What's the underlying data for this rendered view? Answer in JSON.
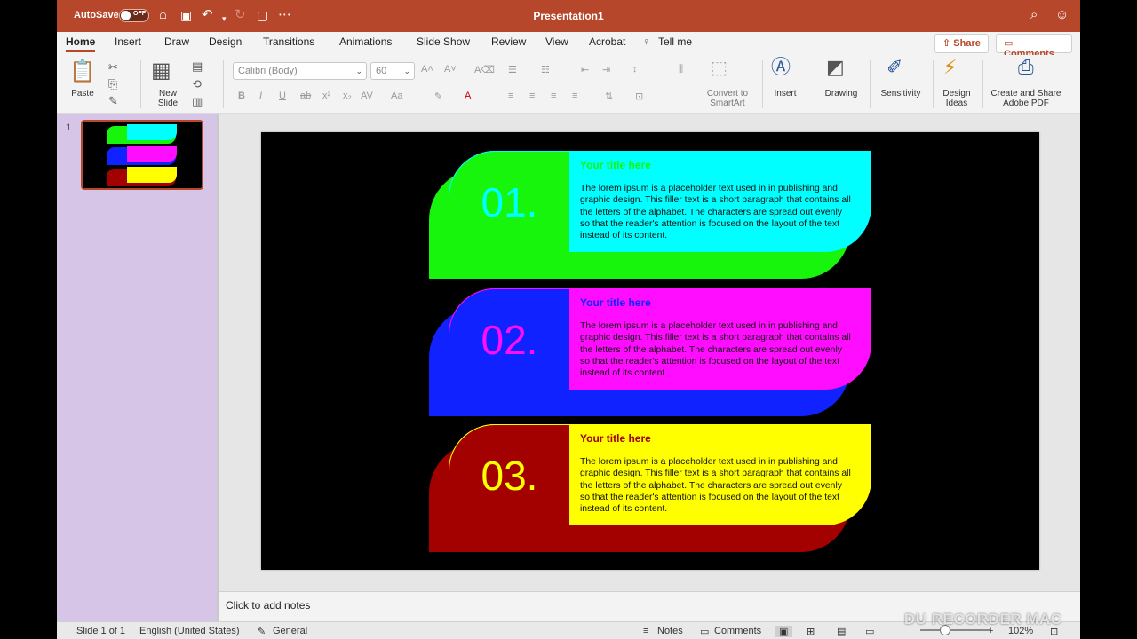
{
  "titlebar": {
    "autosave_label": "AutoSave",
    "autosave_state": "OFF",
    "document_title": "Presentation1"
  },
  "tabs": [
    "Home",
    "Insert",
    "Draw",
    "Design",
    "Transitions",
    "Animations",
    "Slide Show",
    "Review",
    "View",
    "Acrobat",
    "Tell me"
  ],
  "active_tab": "Home",
  "top_buttons": {
    "share": "Share",
    "comments": "Comments"
  },
  "ribbon": {
    "paste": "Paste",
    "new_slide_line1": "New",
    "new_slide_line2": "Slide",
    "font_name": "Calibri (Body)",
    "font_size": "60",
    "convert_smartart_line1": "Convert to",
    "convert_smartart_line2": "SmartArt",
    "insert": "Insert",
    "drawing": "Drawing",
    "sensitivity": "Sensitivity",
    "design_ideas_line1": "Design",
    "design_ideas_line2": "Ideas",
    "adobe_line1": "Create and Share",
    "adobe_line2": "Adobe PDF"
  },
  "thumbnail": {
    "number": "1"
  },
  "slide": {
    "items": [
      {
        "number": "01.",
        "title": "Your title here",
        "body": "The lorem ipsum is a placeholder text used in in publishing and graphic design.  This filler text is a short paragraph that contains all the letters of the alphabet. The characters are spread out evenly so that the reader's attention is focused on the layout of the text instead of its content.",
        "colors": {
          "back": "#17f50c",
          "numbox": "#17f50c",
          "panel": "#00ffff",
          "number": "#00ffff",
          "title": "#17f50c"
        }
      },
      {
        "number": "02.",
        "title": "Your title here",
        "body": "The lorem ipsum is a placeholder text used in in publishing and graphic design.  This filler text is a short paragraph that contains all the letters of the alphabet. The characters are spread out evenly so that the reader's attention is focused on the layout of the text instead of its content.",
        "colors": {
          "back": "#1022ff",
          "numbox": "#1022ff",
          "panel": "#ff0dff",
          "number": "#ff0dff",
          "title": "#1022ff"
        }
      },
      {
        "number": "03.",
        "title": "Your title here",
        "body": "The lorem ipsum is a placeholder text used in in publishing and graphic design.  This filler text is a short paragraph that contains all the letters of the alphabet. The characters are spread out evenly so that the reader's attention is focused on the layout of the text instead of its content.",
        "colors": {
          "back": "#a30000",
          "numbox": "#a30000",
          "panel": "#ffff00",
          "number": "#ffff00",
          "title": "#a30000"
        }
      }
    ]
  },
  "notes_placeholder": "Click to add notes",
  "status": {
    "slide_counter": "Slide 1 of 1",
    "language": "English (United States)",
    "sensitivity": "General",
    "notes": "Notes",
    "comments": "Comments",
    "zoom": "102%"
  },
  "watermark": "DU RECORDER MAC"
}
